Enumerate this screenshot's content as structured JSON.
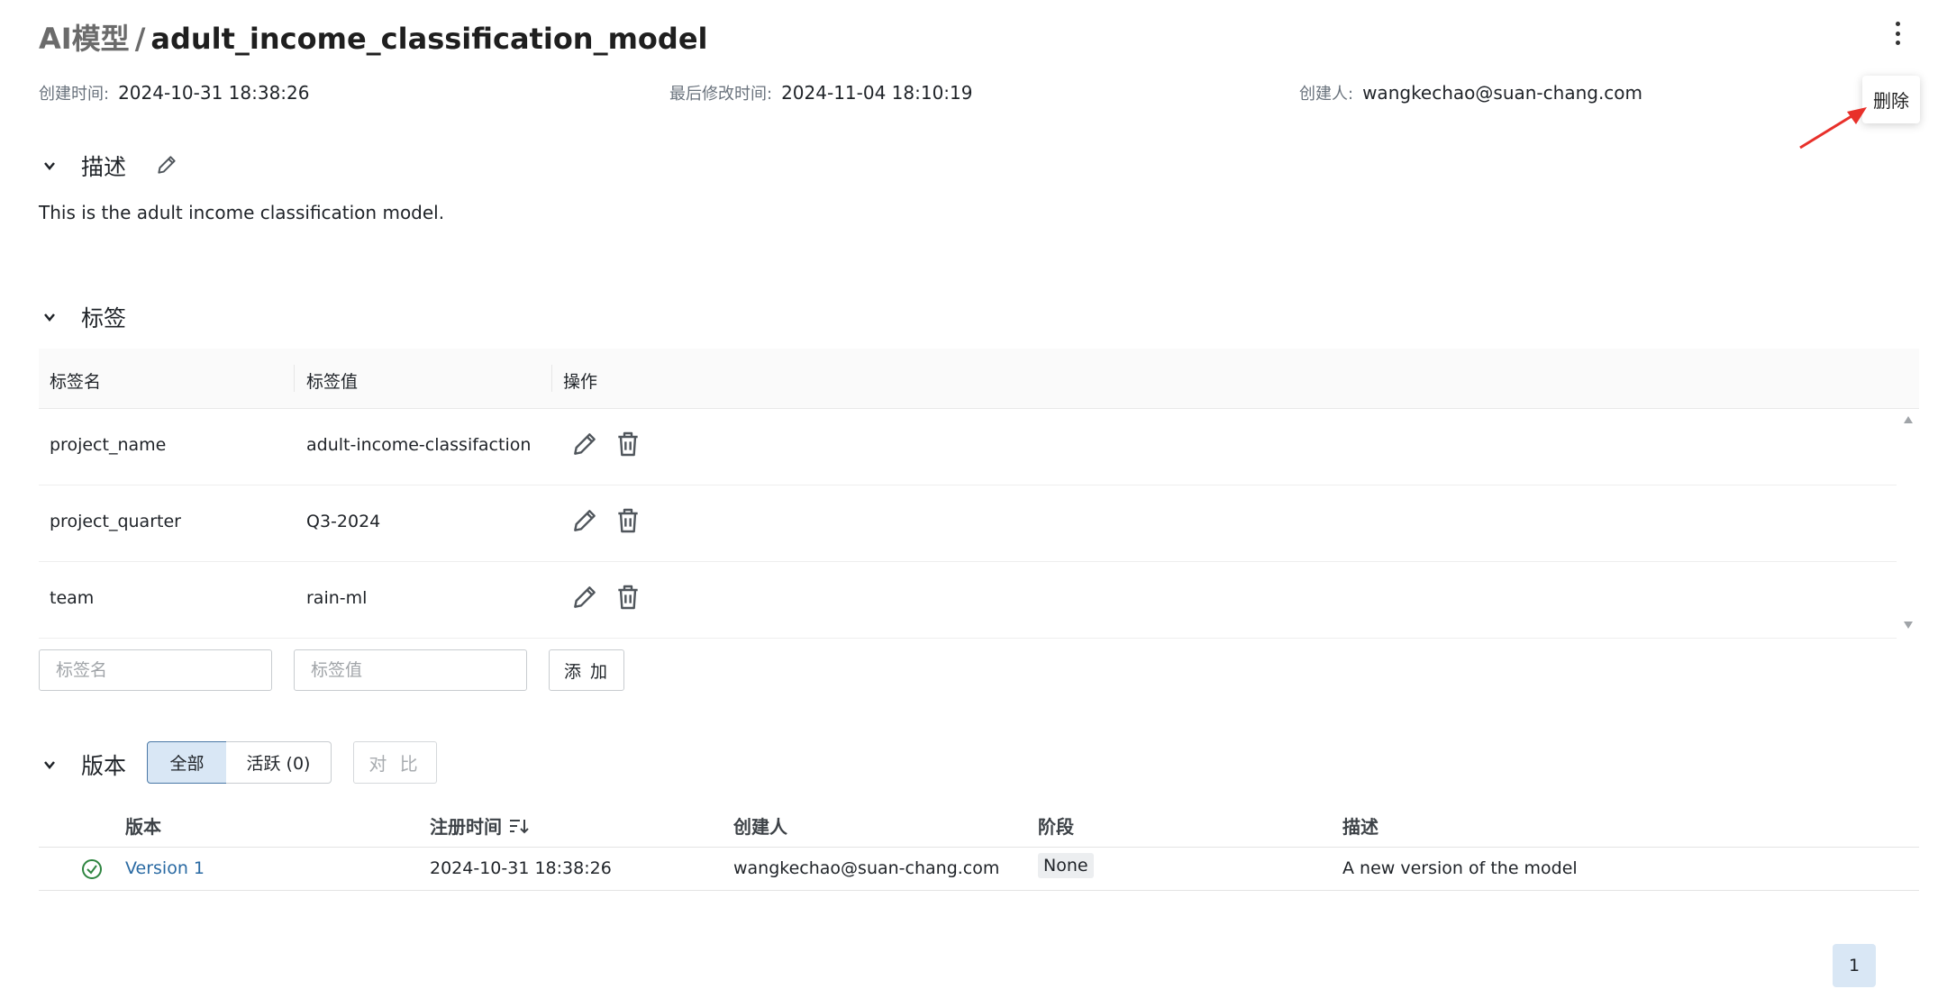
{
  "header": {
    "breadcrumb": "AI模型",
    "separator": "/",
    "model_name": "adult_income_classification_model",
    "menu_icon": "kebab-menu-icon"
  },
  "meta": {
    "created_label": "创建时间:",
    "created_value": "2024-10-31 18:38:26",
    "modified_label": "最后修改时间:",
    "modified_value": "2024-11-04 18:10:19",
    "creator_label": "创建人:",
    "creator_value": "wangkechao@suan-chang.com"
  },
  "menu_popup": {
    "delete_label": "删除"
  },
  "description": {
    "heading": "描述",
    "text": "This is the adult income classification model."
  },
  "tags": {
    "heading": "标签",
    "columns": [
      "标签名",
      "标签值",
      "操作"
    ],
    "rows": [
      {
        "name": "project_name",
        "value": "adult-income-classifaction"
      },
      {
        "name": "project_quarter",
        "value": "Q3-2024"
      },
      {
        "name": "team",
        "value": "rain-ml"
      }
    ],
    "name_placeholder": "标签名",
    "value_placeholder": "标签值",
    "add_label": "添 加"
  },
  "versions": {
    "heading": "版本",
    "filter_all": "全部",
    "filter_active": "活跃 (0)",
    "compare_label": "对 比",
    "columns": [
      "版本",
      "注册时间",
      "创建人",
      "阶段",
      "描述"
    ],
    "rows": [
      {
        "version": "Version 1",
        "registered": "2024-10-31 18:38:26",
        "creator": "wangkechao@suan-chang.com",
        "stage": "None",
        "description": "A new version of the model"
      }
    ]
  },
  "pagination": {
    "current_page": "1"
  },
  "colors": {
    "accent_blue": "#2a6aa3",
    "selected_bg": "#d9e7f5",
    "ready_green": "#2e8540",
    "annotation_red": "#e8302a"
  }
}
